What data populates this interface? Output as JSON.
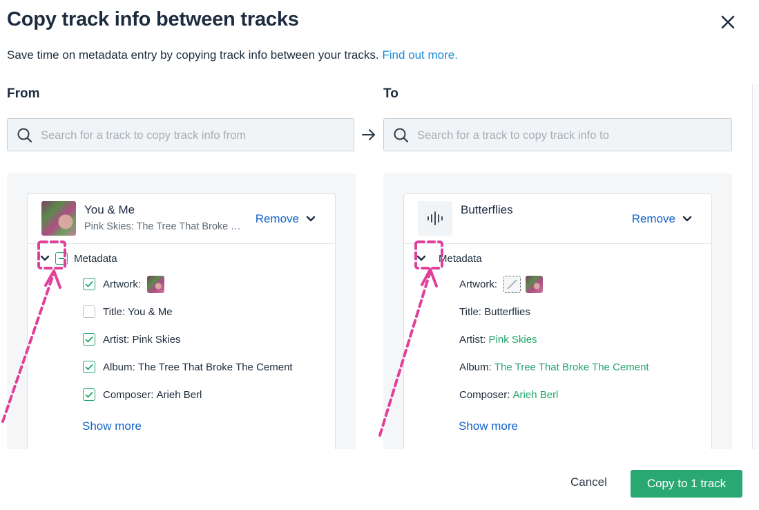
{
  "dialog": {
    "title": "Copy track info between tracks",
    "subtitle": "Save time on metadata entry by copying track info between your tracks.",
    "learn_link": "Find out more."
  },
  "from": {
    "label": "From",
    "search_placeholder": "Search for a track to copy track info from",
    "track": {
      "name": "You & Me",
      "subtitle": "Pink Skies: The Tree That Broke The Cement",
      "remove_label": "Remove"
    },
    "metadata": {
      "label": "Metadata",
      "fields": [
        {
          "label": "Artwork:",
          "value": "",
          "checked": true
        },
        {
          "label": "Title:",
          "value": "You & Me",
          "checked": false
        },
        {
          "label": "Artist:",
          "value": "Pink Skies",
          "checked": true
        },
        {
          "label": "Album:",
          "value": "The Tree That Broke The Cement",
          "checked": true
        },
        {
          "label": "Composer:",
          "value": "Arieh Berl",
          "checked": true
        }
      ],
      "show_more": "Show more"
    }
  },
  "to": {
    "label": "To",
    "search_placeholder": "Search for a track to copy track info to",
    "track": {
      "name": "Butterflies",
      "remove_label": "Remove"
    },
    "metadata": {
      "label": "Metadata",
      "fields": [
        {
          "label": "Artwork:",
          "value": ""
        },
        {
          "label": "Title:",
          "value": "Butterflies"
        },
        {
          "label": "Artist:",
          "value": "Pink Skies"
        },
        {
          "label": "Album:",
          "value": "The Tree That Broke The Cement"
        },
        {
          "label": "Composer:",
          "value": "Arieh Berl"
        }
      ],
      "show_more": "Show more"
    }
  },
  "footer": {
    "cancel_label": "Cancel",
    "copy_label": "Copy to 1 track"
  },
  "colors": {
    "accent_green": "#2aa872",
    "link_blue": "#1463c9",
    "annotation_pink": "#e0409a"
  }
}
